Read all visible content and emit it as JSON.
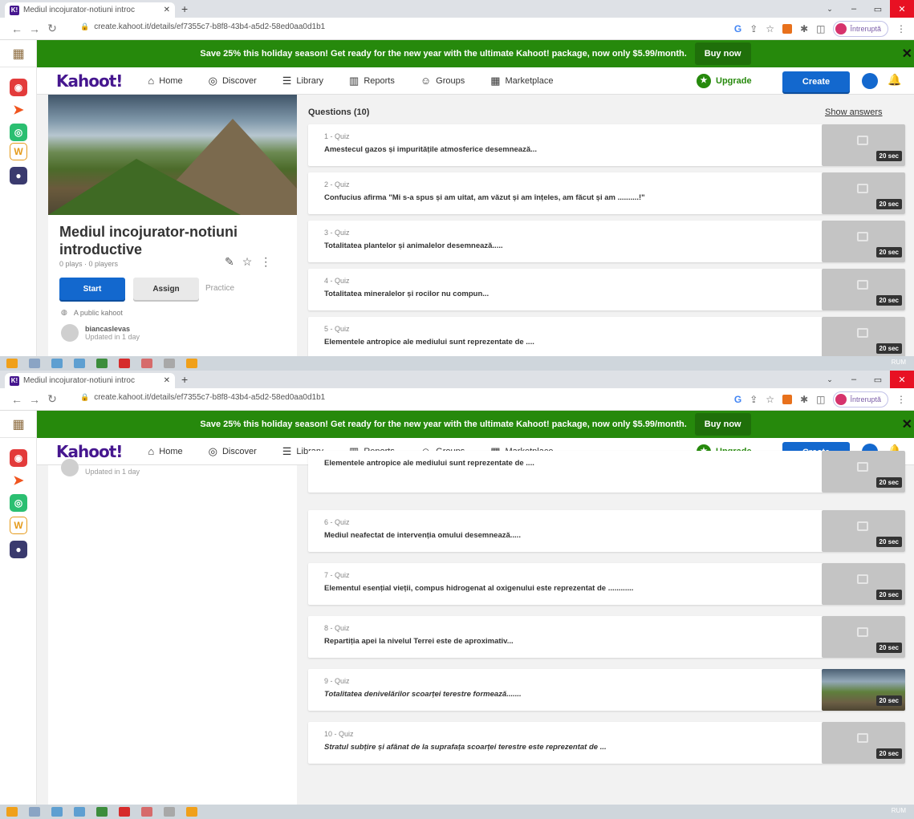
{
  "browser": {
    "tab_title": "Mediul incojurator-notiuni introc",
    "favicon_text": "K!",
    "tab_close": "✕",
    "new_tab": "+",
    "url": "create.kahoot.it/details/ef7355c7-b8f8-43b4-a5d2-58ed0aa0d1b1",
    "profile_status": "Întreruptă",
    "g_label": "G"
  },
  "banner": {
    "text": "Save 25% this holiday season! Get ready for the new year with the ultimate Kahoot! package, now only $5.99/month.",
    "cta": "Buy now",
    "close": "✕"
  },
  "nav": {
    "logo": "Kahoot!",
    "items": [
      {
        "label": "Home",
        "icon": "home-icon",
        "glyph": "⌂"
      },
      {
        "label": "Discover",
        "icon": "compass-icon",
        "glyph": "◎"
      },
      {
        "label": "Library",
        "icon": "list-icon",
        "glyph": "☰"
      },
      {
        "label": "Reports",
        "icon": "bar-chart-icon",
        "glyph": "▥"
      },
      {
        "label": "Groups",
        "icon": "people-icon",
        "glyph": "☺"
      },
      {
        "label": "Marketplace",
        "icon": "store-icon",
        "glyph": "▦"
      }
    ],
    "upgrade": "Upgrade",
    "create": "Create"
  },
  "kahoot": {
    "title": "Mediul incojurator-notiuni introductive",
    "meta": "0 plays · 0 players",
    "start": "Start",
    "assign": "Assign",
    "practice": "Practice",
    "visibility": "A public kahoot",
    "owner": "biancaslevas",
    "updated": "Updated in 1 day"
  },
  "questions": {
    "header": "Questions (10)",
    "show_answers": "Show answers",
    "items": [
      {
        "num": "1 - Quiz",
        "text": "Amestecul gazos și impuritățile atmosferice desemnează...",
        "time": "20 sec",
        "photo": false
      },
      {
        "num": "2 - Quiz",
        "text": "Confucius afirma \"Mi s-a spus și am uitat, am văzut și am înțeles, am făcut și am ..........!\"",
        "time": "20 sec",
        "photo": false
      },
      {
        "num": "3 - Quiz",
        "text": "Totalitatea plantelor și animalelor desemnează.....",
        "time": "20 sec",
        "photo": false
      },
      {
        "num": "4 - Quiz",
        "text": "Totalitatea mineralelor și rocilor nu compun...",
        "time": "20 sec",
        "photo": false
      },
      {
        "num": "5 - Quiz",
        "text": "Elementele antropice ale mediului sunt reprezentate de ....",
        "time": "20 sec",
        "photo": false
      },
      {
        "num": "6 - Quiz",
        "text": "Mediul neafectat de intervenția omului desemnează.....",
        "time": "20 sec",
        "photo": false
      },
      {
        "num": "7 - Quiz",
        "text": "Elementul esențial vieții, compus hidrogenat al oxigenului este reprezentat de ............",
        "time": "20 sec",
        "photo": false
      },
      {
        "num": "8 - Quiz",
        "text": "Repartiția apei la nivelul Terrei este de aproximativ...",
        "time": "20 sec",
        "photo": false
      },
      {
        "num": "9 - Quiz",
        "text": "Totalitatea denivelărilor scoarței terestre formează.......",
        "time": "20 sec",
        "photo": true
      },
      {
        "num": "10 - Quiz",
        "text": "Stratul subțire și afânat de la suprafața scoarței terestre este reprezentat de ...",
        "time": "20 sec",
        "photo": false
      }
    ]
  },
  "taskbar": {
    "tray": "RUM"
  }
}
